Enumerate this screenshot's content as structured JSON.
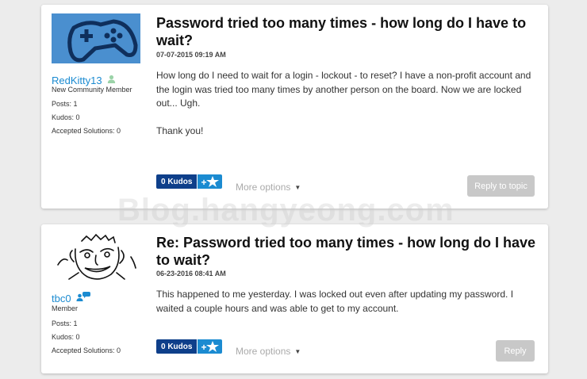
{
  "posts": [
    {
      "author": {
        "name": "RedKitty13",
        "rank": "New Community Member",
        "posts": "Posts: 1",
        "kudos": "Kudos: 0",
        "solutions": "Accepted Solutions: 0"
      },
      "title": "Password tried too many times - how long do I have to wait?",
      "date": "07-07-2015 09:19 AM",
      "body": [
        "How long do I need to wait for a login - lockout - to reset? I have a non-profit account and the login was tried too many times by another person on the board. Now we are locked out... Ugh.",
        "Thank you!"
      ],
      "kudos_label": "0 Kudos",
      "more_options": "More options",
      "reply_label": "Reply to topic"
    },
    {
      "author": {
        "name": "tbc0",
        "rank": "Member",
        "posts": "Posts: 1",
        "kudos": "Kudos: 0",
        "solutions": "Accepted Solutions: 0"
      },
      "title": "Re: Password tried too many times - how long do I have to wait?",
      "date": "06-23-2016 08:41 AM",
      "body": [
        "This happened to me yesterday. I was locked out even after updating my password. I waited a couple hours and was able to get to my account."
      ],
      "kudos_label": "0 Kudos",
      "more_options": "More options",
      "reply_label": "Reply"
    }
  ],
  "watermark": "Blog.hangyeong.com",
  "icons": {
    "avatar_1": "gamepad-avatar",
    "avatar_2": "cartoon-face-avatar",
    "user_1": "user-icon",
    "user_2": "group-chat-icon",
    "kudos_give": "plus-star-icon",
    "more": "caret-down-icon"
  },
  "colors": {
    "link": "#1b8bd1",
    "kudos_dark": "#0e3f8a",
    "kudos_light": "#1b8bd1",
    "button_disabled": "#c8c8c8",
    "avatar_bg": "#4a8fcf"
  }
}
